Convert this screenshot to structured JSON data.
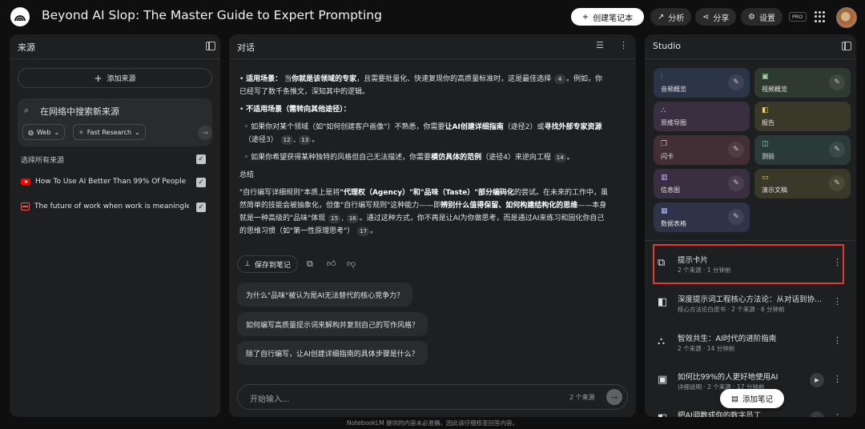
{
  "header": {
    "title": "Beyond AI Slop: The Master Guide to Expert Prompting",
    "create_notebook": "创建笔记本",
    "analyze": "分析",
    "share": "分享",
    "settings": "设置",
    "badge": "PRO"
  },
  "sources": {
    "title": "来源",
    "add_label": "添加来源",
    "search_placeholder": "在网络中搜索新来源",
    "chip_web": "Web",
    "chip_research": "Fast Research",
    "select_all": "选择所有来源",
    "items": [
      {
        "label": "How To Use AI Better Than 99% Of People (...",
        "icon": "youtube-icon"
      },
      {
        "label": "The future of work when work is meaningles...",
        "icon": "document-icon"
      }
    ]
  },
  "chat": {
    "title": "对话",
    "p1_label": "适用场景：",
    "p1_text_a": "当",
    "p1_bold": "你就是该领域的专家",
    "p1_text_b": "，且需要批量化、快速复现你的高质量标准时，这是最佳选择",
    "p1_cite": "4",
    "p1_text_c": "。例如，你已经写了数千条推文，深知其中的逻辑。",
    "p2_label": "不适用场景（需转向其他途径）：",
    "p3_text_a": "◦ 如果你对某个领域（如\"如何创建客户画像\"）不熟悉，你需要",
    "p3_bold_a": "让AI创建详细指南",
    "p3_text_b": "（途径2）或",
    "p3_bold_b": "寻找外部专家资源",
    "p3_text_c": "（途径3）",
    "p3_cite_a": "12",
    "p3_cite_b": "13",
    "p4_text_a": "◦ 如果你希望获得某种独特的风格但自己无法描述，你需要",
    "p4_bold": "模仿具体的范例",
    "p4_text_b": "（途径4）来逆向工程",
    "p4_cite": "14",
    "summary_title": "总结",
    "p5_text_a": "\"自行编写详细规则\"本质上是将",
    "p5_bold_a": "\"代理权（Agency）\"和\"品味（Taste）\"部分编码化",
    "p5_text_b": "的尝试。在未来的工作中，虽然简单的技能会被抽象化，但像\"自行编写规则\"这种能力——即",
    "p5_bold_b": "辨别什么值得保留、如何构建结构化的思维",
    "p5_text_c": "——本身就是一种高级的\"品味\"体现",
    "p5_cite_a": "15",
    "p5_cite_b": "16",
    "p5_text_d": "。通过这种方式，你不再是让AI为你做思考，而是通过AI来练习和固化你自己的思维习惯（如\"第一性原理思考\"）",
    "p5_cite_c": "17",
    "save_note": "保存到笔记",
    "suggestions": [
      "为什么\"品味\"被认为是AI无法替代的核心竞争力？",
      "如何编写高质量提示词来解构并复刻自己的写作风格？",
      "除了自行编写，让AI创建详细指南的具体步骤是什么？"
    ],
    "input_placeholder": "开始输入...",
    "source_count": "2 个来源"
  },
  "studio": {
    "title": "Studio",
    "tiles": [
      {
        "label": "音频概览",
        "icon": "audio-icon"
      },
      {
        "label": "视频概览",
        "icon": "video-icon"
      },
      {
        "label": "思维导图",
        "icon": "mindmap-icon"
      },
      {
        "label": "报告",
        "icon": "report-icon"
      },
      {
        "label": "闪卡",
        "icon": "flashcard-icon"
      },
      {
        "label": "测验",
        "icon": "quiz-icon"
      },
      {
        "label": "信息图",
        "icon": "infographic-icon"
      },
      {
        "label": "演示文稿",
        "icon": "slides-icon"
      },
      {
        "label": "数据表格",
        "icon": "table-icon"
      }
    ],
    "notes": [
      {
        "title": "提示卡片",
        "meta": "2 个来源 · 1 分钟前"
      },
      {
        "title": "深度提示词工程核心方法论：从对话到协...",
        "meta": "核心方法论白皮书 · 2 个来源 · 6 分钟前"
      },
      {
        "title": "智效共生：AI时代的进阶指南",
        "meta": "2 个来源 · 14 分钟前"
      },
      {
        "title": "如何比99%的人更好地使用AI",
        "meta": "详细说明 · 2 个来源 · 17 分钟前"
      },
      {
        "title": "把AI调教成你的数字员工",
        "meta": ""
      }
    ],
    "add_note": "添加笔记"
  },
  "footer": "NotebookLM 提供的内容未必准确，因此请仔细核查回答内容。"
}
